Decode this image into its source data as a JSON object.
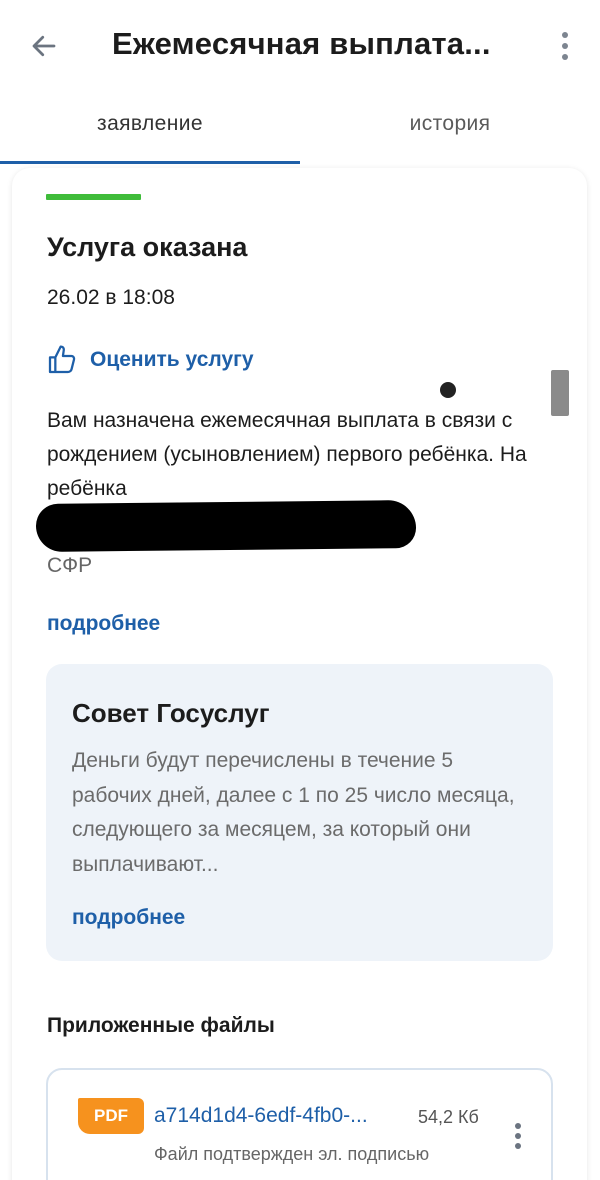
{
  "appbar": {
    "title": "Ежемесячная выплата...",
    "back_icon": "arrow-back-icon",
    "more_icon": "more-vertical-icon"
  },
  "tabs": [
    {
      "label": "заявление",
      "active": true
    },
    {
      "label": "история",
      "active": false
    }
  ],
  "status": {
    "title": "Услуга оказана",
    "date": "26.02 в 18:08",
    "indicator_color": "#3fbc3a"
  },
  "rate": {
    "label": "Оценить услугу",
    "icon": "thumb-up-icon"
  },
  "message": {
    "text": "Вам назначена ежемесячная выплата в связи с рождением (усыновлением) первого ребёнка. На ребёнка",
    "org": "СФР",
    "more_label": "подробнее"
  },
  "advice": {
    "title": "Совет Госуслуг",
    "text": "Деньги будут перечислены в течение 5 рабочих дней, далее с 1 по 25 число месяца, следующего за месяцем, за который они выплачивают...",
    "more_label": "подробнее"
  },
  "files": {
    "title": "Приложенные файлы",
    "items": [
      {
        "type": "PDF",
        "name": "a714d1d4-6edf-4fb0-...",
        "size": "54,2 Кб",
        "status": "Файл подтвержден эл. подписью"
      }
    ]
  },
  "colors": {
    "accent": "#1e5fa8",
    "success": "#3fbc3a",
    "pdf": "#f6921e",
    "advice_bg": "#eef3f9"
  }
}
